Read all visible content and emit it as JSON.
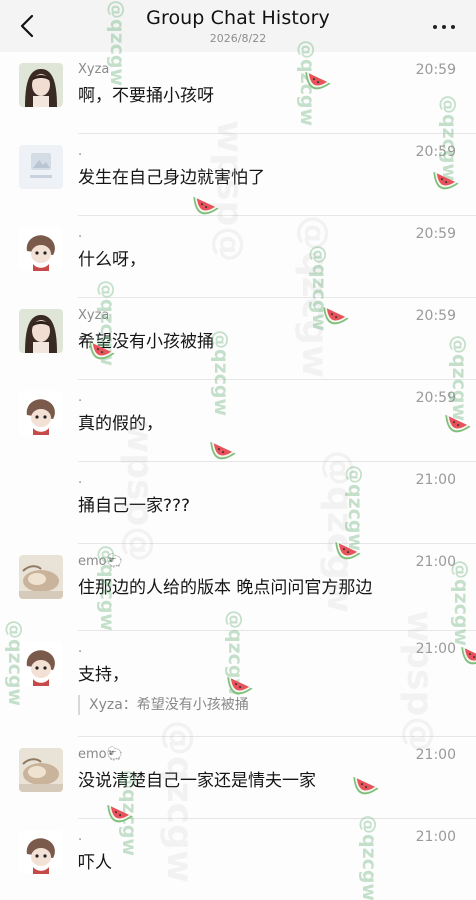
{
  "header": {
    "title": "Group Chat History",
    "date": "2026/8/22",
    "back_icon": "chevron-left-icon",
    "more_icon": "more-dots-icon"
  },
  "messages": [
    {
      "sender": "Xyza",
      "time": "20:59",
      "text": "啊，不要捅小孩呀",
      "avatar": "avatar-girl"
    },
    {
      "sender": ".",
      "time": "20:59",
      "text": "发生在自己身边就害怕了",
      "avatar": "avatar-placeholder"
    },
    {
      "sender": ".",
      "time": "20:59",
      "text": "什么呀，",
      "avatar": "avatar-cartoon"
    },
    {
      "sender": "Xyza",
      "time": "20:59",
      "text": "希望没有小孩被捅",
      "avatar": "avatar-girl"
    },
    {
      "sender": ".",
      "time": "20:59",
      "text": "真的假的，",
      "avatar": "avatar-cartoon"
    },
    {
      "sender": ".",
      "time": "21:00",
      "text": "捅自己一家???",
      "avatar": "none"
    },
    {
      "sender": "emo🐑",
      "time": "21:00",
      "text": "住那边的人给的版本 晚点问问官方那边",
      "avatar": "avatar-cat"
    },
    {
      "sender": ".",
      "time": "21:00",
      "text": "支持，",
      "quote": "Xyza：希望没有小孩被捅",
      "avatar": "avatar-cartoon"
    },
    {
      "sender": "emo🐑",
      "time": "21:00",
      "text": "没说清楚自己一家还是情夫一家",
      "avatar": "avatar-cat"
    },
    {
      "sender": ".",
      "time": "21:00",
      "text": "吓人",
      "avatar": "avatar-cartoon"
    }
  ],
  "watermark": {
    "text": "@qzcgw",
    "brand_text": "wpsp@"
  },
  "colors": {
    "header_bg": "#f4f4f4",
    "divider": "#e6e6e6",
    "meta_text": "#9a9a9a",
    "watermark_green": "#5aaa6e"
  }
}
